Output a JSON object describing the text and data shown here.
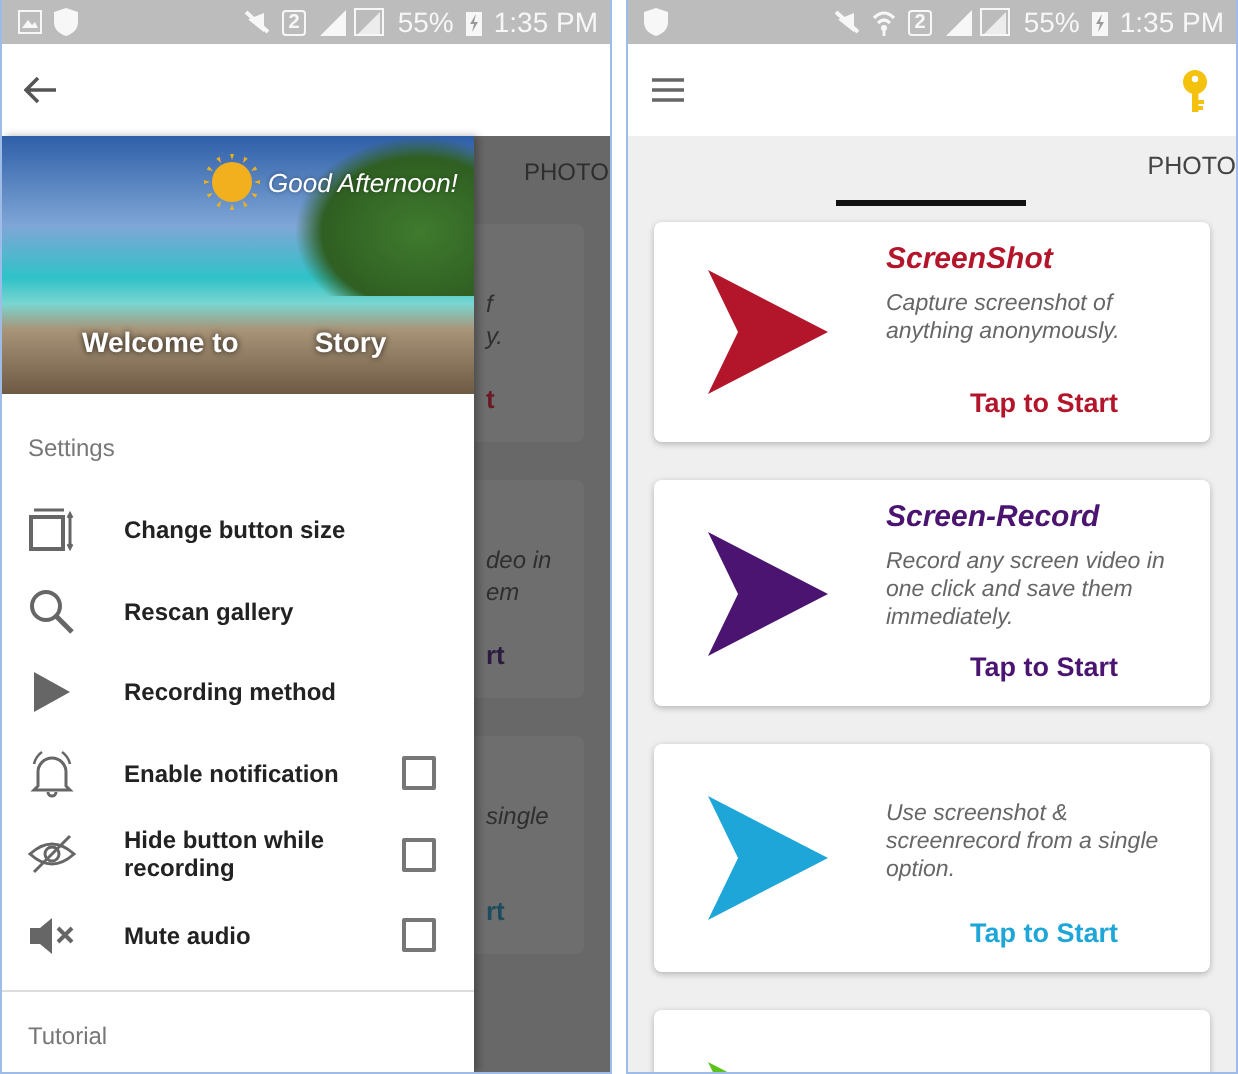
{
  "left_screen": {
    "status_bar": {
      "gallery_notification": true,
      "wifi": false,
      "sim": "2",
      "battery": "55%",
      "time": "1:35 PM"
    },
    "background": {
      "tabs": [
        {
          "label": "PHOTO",
          "selected": false
        }
      ],
      "cards": [
        {
          "color": "#6a1a24",
          "description": [
            "f",
            "y."
          ],
          "action": "t"
        },
        {
          "color": "#2c1a40",
          "description": [
            "deo in",
            "em"
          ],
          "action": "rt"
        },
        {
          "color": "#1c4c5e",
          "description": [
            "single"
          ],
          "action": "rt"
        }
      ]
    },
    "drawer": {
      "greeting": "Good Afternoon!",
      "welcome": "Welcome to",
      "app_name": "Story",
      "sections": [
        {
          "title": "Settings",
          "items": [
            {
              "kind": "action",
              "label": "Change button size"
            },
            {
              "kind": "action",
              "label": "Rescan gallery"
            },
            {
              "kind": "action",
              "label": "Recording method"
            },
            {
              "kind": "toggle",
              "label": "Enable notification",
              "checked": false
            },
            {
              "kind": "toggle",
              "label": "Hide button while recording",
              "checked": false
            },
            {
              "kind": "toggle",
              "label": "Mute audio",
              "checked": false
            }
          ]
        },
        {
          "title": "Tutorial"
        }
      ]
    }
  },
  "right_screen": {
    "status_bar": {
      "gallery_notification": false,
      "wifi": true,
      "sim": "2",
      "battery": "55%",
      "time": "1:35 PM"
    },
    "tabs": [
      {
        "selected": true
      },
      {
        "label": "PHOTO",
        "selected": false
      }
    ],
    "cards": [
      {
        "color": "#b3162b",
        "title": "ScreenShot",
        "description": "Capture screenshot of anything anonymously.",
        "action": "Tap to Start"
      },
      {
        "color": "#4a1470",
        "title": "Screen-Record",
        "description": "Record any screen video in one click and save them immediately.",
        "action": "Tap to Start"
      },
      {
        "color": "#1ea6d8",
        "description": "Use screenshot & screenrecord from a single option.",
        "action": "Tap to Start"
      },
      {
        "color": "#5cc21c"
      }
    ]
  }
}
